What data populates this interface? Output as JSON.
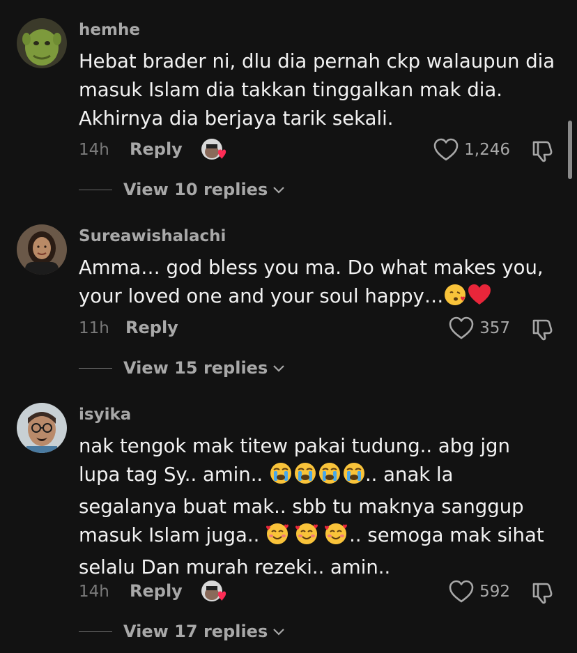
{
  "comments": [
    {
      "username": "hemhe",
      "text": "Hebat brader ni, dlu dia pernah ckp walaupun dia\nmasuk Islam dia takkan tinggalkan mak dia.\nAkhirnya dia berjaya tarik sekali.",
      "time": "14h",
      "reply_label": "Reply",
      "likes": "1,246",
      "view_replies": "View 10 replies",
      "creator_liked": true,
      "avatar_icon": "green-ogre-avatar"
    },
    {
      "username": "Sureawishalachi",
      "text_part1": "Amma… god bless you ma. Do what makes you,\nyour loved one and your soul happy…",
      "emoji_1": "😘",
      "emoji_2": "❤️",
      "time": "11h",
      "reply_label": "Reply",
      "likes": "357",
      "view_replies": "View 15 replies",
      "creator_liked": false,
      "avatar_icon": "woman-avatar"
    },
    {
      "username": "isyika",
      "line1": "nak tengok mak titew pakai tudung.. abg jgn",
      "line2_a": "lupa tag Sy.. amin..",
      "line2_emojis": "😭😭😭😭",
      "line2_b": ".. anak la",
      "line3": "segalanya buat mak.. sbb tu maknya sanggup",
      "line4_a": "masuk Islam juga..",
      "line4_emojis": "🥰🥰🥰",
      "line4_b": ".. semoga mak sihat",
      "line5": "selalu Dan murah rezeki.. amin..",
      "time": "14h",
      "reply_label": "Reply",
      "likes": "592",
      "view_replies": "View 17 replies",
      "creator_liked": true,
      "avatar_icon": "man-glasses-avatar"
    }
  ],
  "colors": {
    "background": "#121212",
    "text": "#f2f2f2",
    "muted": "#a8a8a8",
    "timestamp": "#7a7a7a",
    "heart_badge": "#fe2c55"
  }
}
